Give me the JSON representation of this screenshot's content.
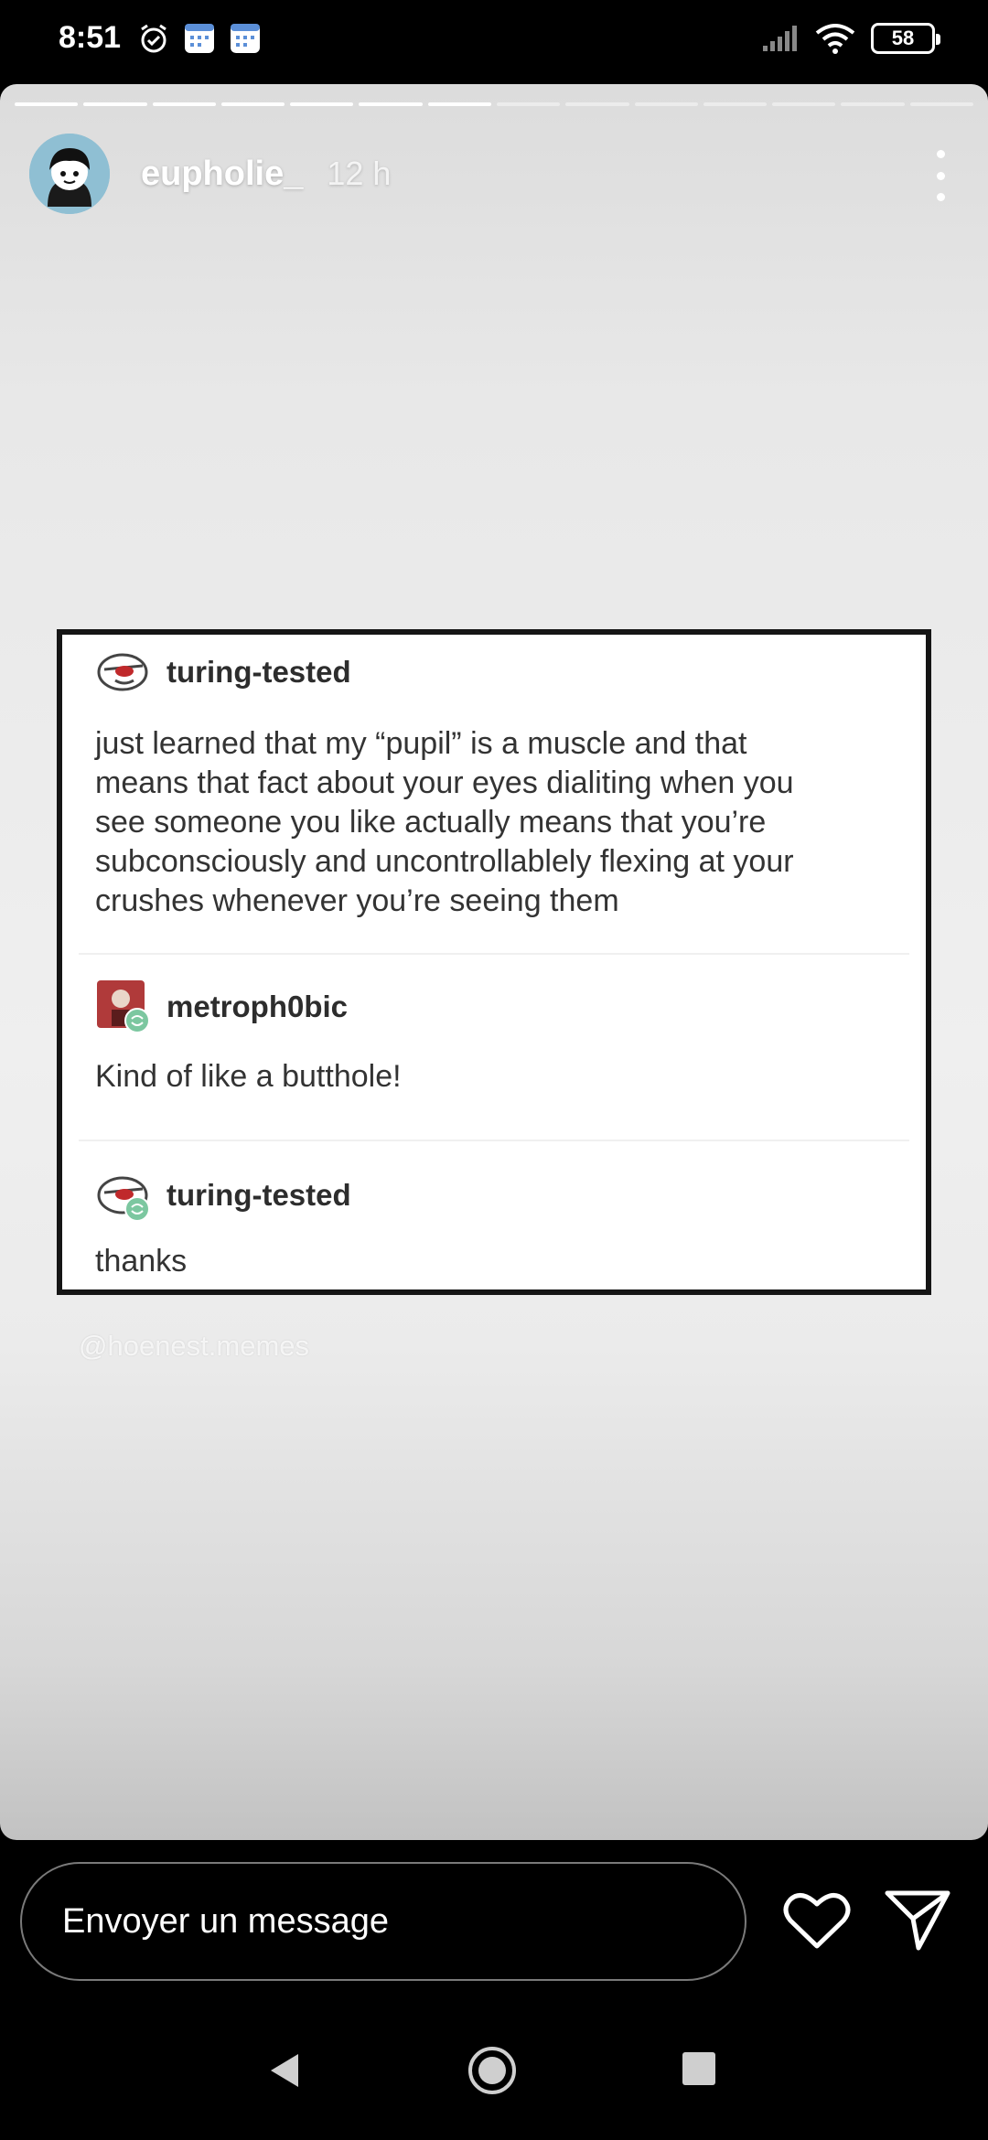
{
  "status_bar": {
    "time": "8:51",
    "battery": "58"
  },
  "story": {
    "username": "eupholie_",
    "time_ago": "12 h",
    "progress_segments_total": 14,
    "progress_segments_done": 7,
    "watermark": "@hoenest.memes"
  },
  "post": {
    "entries": [
      {
        "name": "turing-tested",
        "lines": [
          "just learned that my “pupil” is a muscle and that",
          "means that fact about your eyes dialiting when you",
          "see someone you like actually means that you’re",
          "subconsciously and uncontrollablely flexing at your",
          "crushes whenever you’re seeing them"
        ]
      },
      {
        "name": "metroph0bic",
        "lines": [
          "Kind of like a butthole!"
        ]
      },
      {
        "name": "turing-tested",
        "lines": [
          "thanks"
        ]
      }
    ]
  },
  "reply": {
    "placeholder": "Envoyer un message"
  },
  "colors": {
    "story_bg": "#efefef",
    "card_border": "#151515",
    "reblog_green": "#7cc7a0"
  }
}
